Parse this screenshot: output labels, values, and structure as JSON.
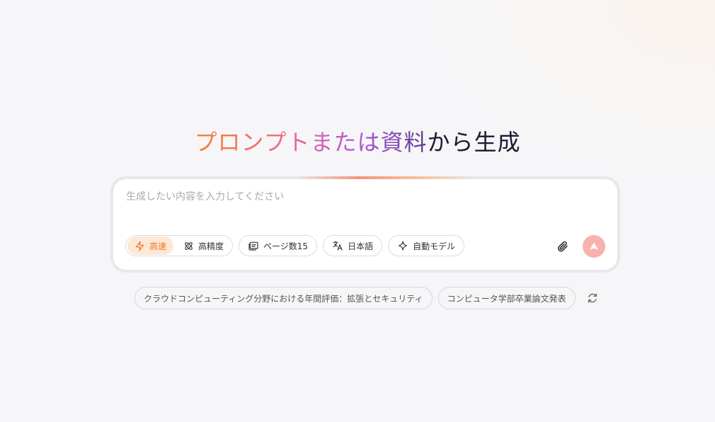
{
  "headline": {
    "gradient_part": "プロンプトまたは資料",
    "dark_part": "から生成"
  },
  "prompt": {
    "placeholder": "生成したい内容を入力してください",
    "value": ""
  },
  "mode_toggle": {
    "options": [
      {
        "label": "高速",
        "icon": "lightning-icon",
        "active": true
      },
      {
        "label": "高精度",
        "icon": "atom-icon",
        "active": false
      }
    ]
  },
  "chips": {
    "pages": {
      "label": "ページ数15",
      "icon": "pages-icon"
    },
    "language": {
      "label": "日本語",
      "icon": "translate-icon"
    },
    "model": {
      "label": "自動モデル",
      "icon": "sparkle-icon"
    }
  },
  "actions": {
    "attach_icon": "paperclip-icon",
    "send_icon": "send-arrow-icon"
  },
  "suggestions": [
    "クラウドコンピューティング分野における年間評価：拡張とセキュリティ",
    "コンピュータ学部卒業論文発表"
  ],
  "colors": {
    "accent_orange": "#e8762b",
    "accent_bg": "#fde8d6",
    "send_button": "#f8b2ae",
    "headline_dark": "#1c1a2e"
  }
}
